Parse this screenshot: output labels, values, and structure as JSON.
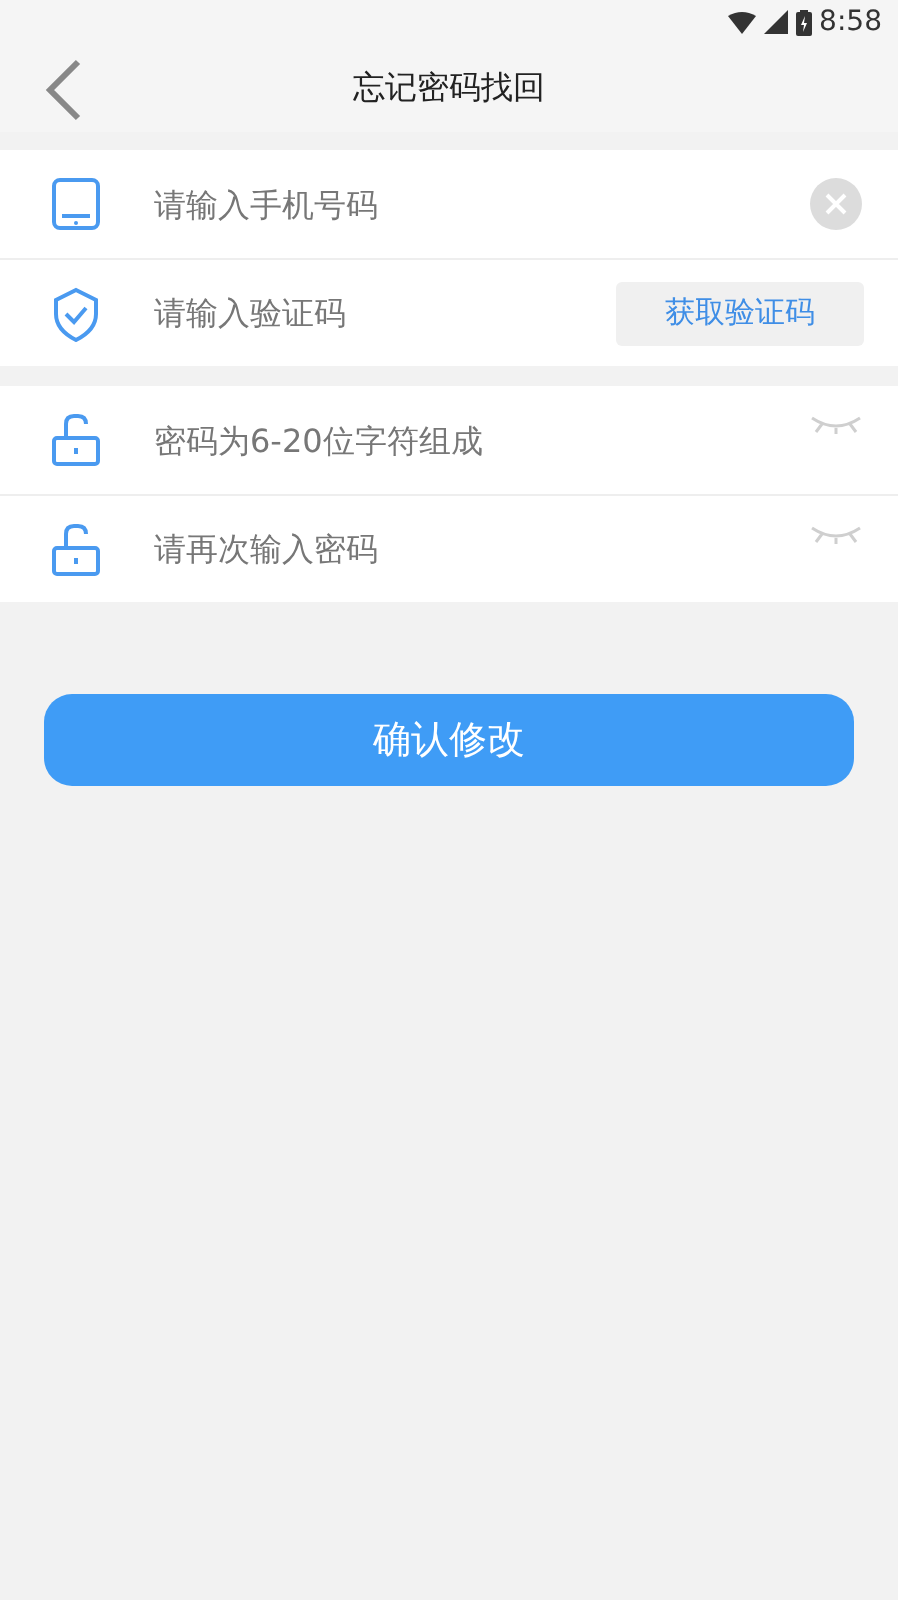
{
  "status_bar": {
    "time": "8:58"
  },
  "header": {
    "title": "忘记密码找回"
  },
  "groups": [
    {
      "fields": [
        {
          "kind": "phone",
          "placeholder": "请输入手机号码"
        },
        {
          "kind": "code",
          "placeholder": "请输入验证码",
          "button_label": "获取验证码"
        }
      ]
    },
    {
      "fields": [
        {
          "kind": "password",
          "placeholder": "密码为6-20位字符组成"
        },
        {
          "kind": "password",
          "placeholder": "请再次输入密码"
        }
      ]
    }
  ],
  "submit_button": {
    "label": "确认修改"
  }
}
